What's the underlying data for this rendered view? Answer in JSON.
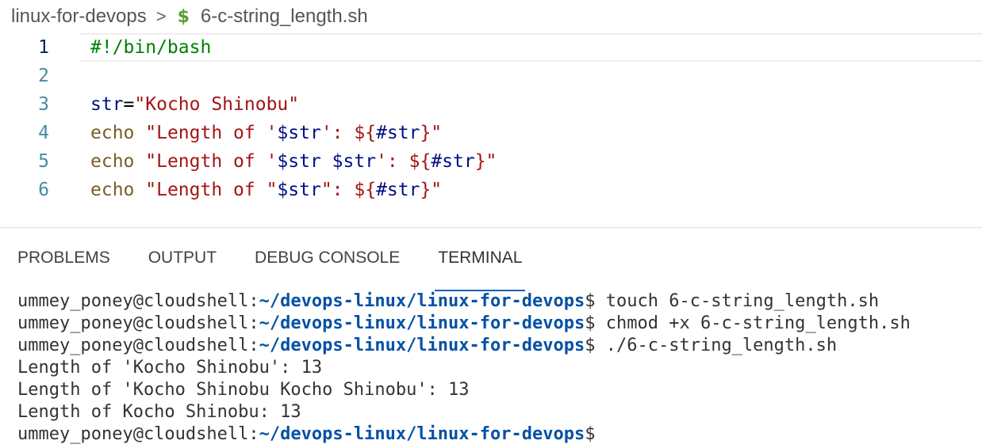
{
  "breadcrumb": {
    "folder": "linux-for-devops",
    "separator": ">",
    "file_icon": "$",
    "file": "6-c-string_length.sh"
  },
  "editor": {
    "lines": [
      {
        "number": "1",
        "tokens": [
          {
            "t": "#!/bin/bash",
            "c": "comment"
          }
        ]
      },
      {
        "number": "2",
        "tokens": []
      },
      {
        "number": "3",
        "tokens": [
          {
            "t": "str",
            "c": "var"
          },
          {
            "t": "=",
            "c": "op"
          },
          {
            "t": "\"Kocho Shinobu\"",
            "c": "str"
          }
        ]
      },
      {
        "number": "4",
        "tokens": [
          {
            "t": "echo",
            "c": "kw"
          },
          {
            "t": " ",
            "c": "plain"
          },
          {
            "t": "\"Length of '",
            "c": "str"
          },
          {
            "t": "$str",
            "c": "var"
          },
          {
            "t": "': ",
            "c": "str"
          },
          {
            "t": "${",
            "c": "str"
          },
          {
            "t": "#str",
            "c": "var"
          },
          {
            "t": "}\"",
            "c": "str"
          }
        ]
      },
      {
        "number": "5",
        "tokens": [
          {
            "t": "echo",
            "c": "kw"
          },
          {
            "t": " ",
            "c": "plain"
          },
          {
            "t": "\"Length of '",
            "c": "str"
          },
          {
            "t": "$str",
            "c": "var"
          },
          {
            "t": " ",
            "c": "str"
          },
          {
            "t": "$str",
            "c": "var"
          },
          {
            "t": "': ",
            "c": "str"
          },
          {
            "t": "${",
            "c": "str"
          },
          {
            "t": "#str",
            "c": "var"
          },
          {
            "t": "}\"",
            "c": "str"
          }
        ]
      },
      {
        "number": "6",
        "tokens": [
          {
            "t": "echo",
            "c": "kw"
          },
          {
            "t": " ",
            "c": "plain"
          },
          {
            "t": "\"Length of \"",
            "c": "str"
          },
          {
            "t": "$str",
            "c": "var"
          },
          {
            "t": "\": ",
            "c": "str"
          },
          {
            "t": "${",
            "c": "str"
          },
          {
            "t": "#str",
            "c": "var"
          },
          {
            "t": "}\"",
            "c": "str"
          }
        ]
      }
    ]
  },
  "panel": {
    "tabs": [
      {
        "label": "PROBLEMS",
        "active": false
      },
      {
        "label": "OUTPUT",
        "active": false
      },
      {
        "label": "DEBUG CONSOLE",
        "active": false
      },
      {
        "label": "TERMINAL",
        "active": true
      }
    ]
  },
  "terminal": {
    "lines": [
      {
        "user": "ummey_poney@cloudshell:",
        "path": "~/devops-linux/linux-for-devops",
        "dollar": "$",
        "cmd": " touch 6-c-string_length.sh"
      },
      {
        "user": "ummey_poney@cloudshell:",
        "path": "~/devops-linux/linux-for-devops",
        "dollar": "$",
        "cmd": " chmod +x 6-c-string_length.sh"
      },
      {
        "user": "ummey_poney@cloudshell:",
        "path": "~/devops-linux/linux-for-devops",
        "dollar": "$",
        "cmd": " ./6-c-string_length.sh"
      },
      {
        "output": "Length of 'Kocho Shinobu': 13"
      },
      {
        "output": "Length of 'Kocho Shinobu Kocho Shinobu': 13"
      },
      {
        "output": "Length of Kocho Shinobu: 13"
      },
      {
        "user": "ummey_poney@cloudshell:",
        "path": "~/devops-linux/linux-for-devops",
        "dollar": "$",
        "cmd": ""
      }
    ]
  },
  "colors": {
    "prompt_path": "#0451a5",
    "active_tab_underline": "#005fb8",
    "shell_icon": "#5a9e34"
  }
}
